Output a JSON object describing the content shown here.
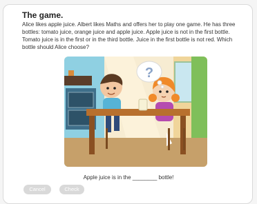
{
  "task": {
    "title": "The game.",
    "text": "Alice likes apple juice. Albert likes Maths and offers her to play one game. He has three bottles: tomato juice, orange juice and apple juice. Apple juice is not in the first bottle. Tomato juice is in the first or in the third bottle. Juice in the first bottle is not red. Which bottle should Alice choose?"
  },
  "illustration": {
    "thought_symbol": "?"
  },
  "answer": {
    "prefix": "Apple juice is in the",
    "blank": "________",
    "suffix": "bottle!"
  },
  "buttons": {
    "cancel": "Cancel",
    "check": "Check"
  }
}
